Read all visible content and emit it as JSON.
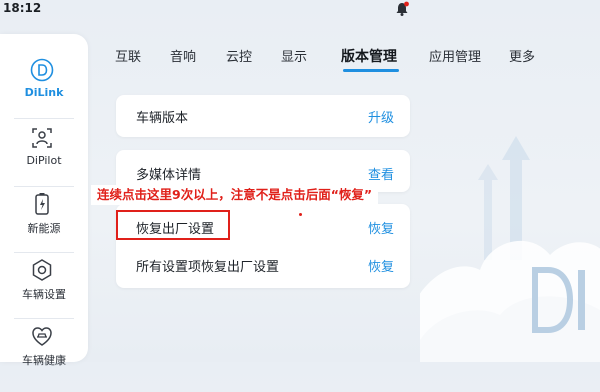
{
  "status": {
    "time": "18:12"
  },
  "sidebar": {
    "items": [
      {
        "label": "DiLink",
        "icon": "dilink-icon"
      },
      {
        "label": "DiPilot",
        "icon": "dipilot-icon"
      },
      {
        "label": "新能源",
        "icon": "battery-icon"
      },
      {
        "label": "车辆设置",
        "icon": "hexagon-settings-icon"
      },
      {
        "label": "车辆健康",
        "icon": "car-health-icon"
      }
    ]
  },
  "tabs": [
    "互联",
    "音响",
    "云控",
    "显示",
    "版本管理",
    "应用管理",
    "更多"
  ],
  "active_tab": "版本管理",
  "cards": {
    "vehicle_version": {
      "label": "车辆版本",
      "action": "升级"
    },
    "media_details": {
      "label": "多媒体详情",
      "action": "查看"
    },
    "factory_reset": {
      "label": "恢复出厂设置",
      "action": "恢复"
    },
    "reset_all": {
      "label": "所有设置项恢复出厂设置",
      "action": "恢复"
    }
  },
  "annotation": "连续点击这里9次以上，注意不是点击后面“恢复”",
  "colors": {
    "accent": "#1f8fe0",
    "annotation": "#e0201a"
  }
}
